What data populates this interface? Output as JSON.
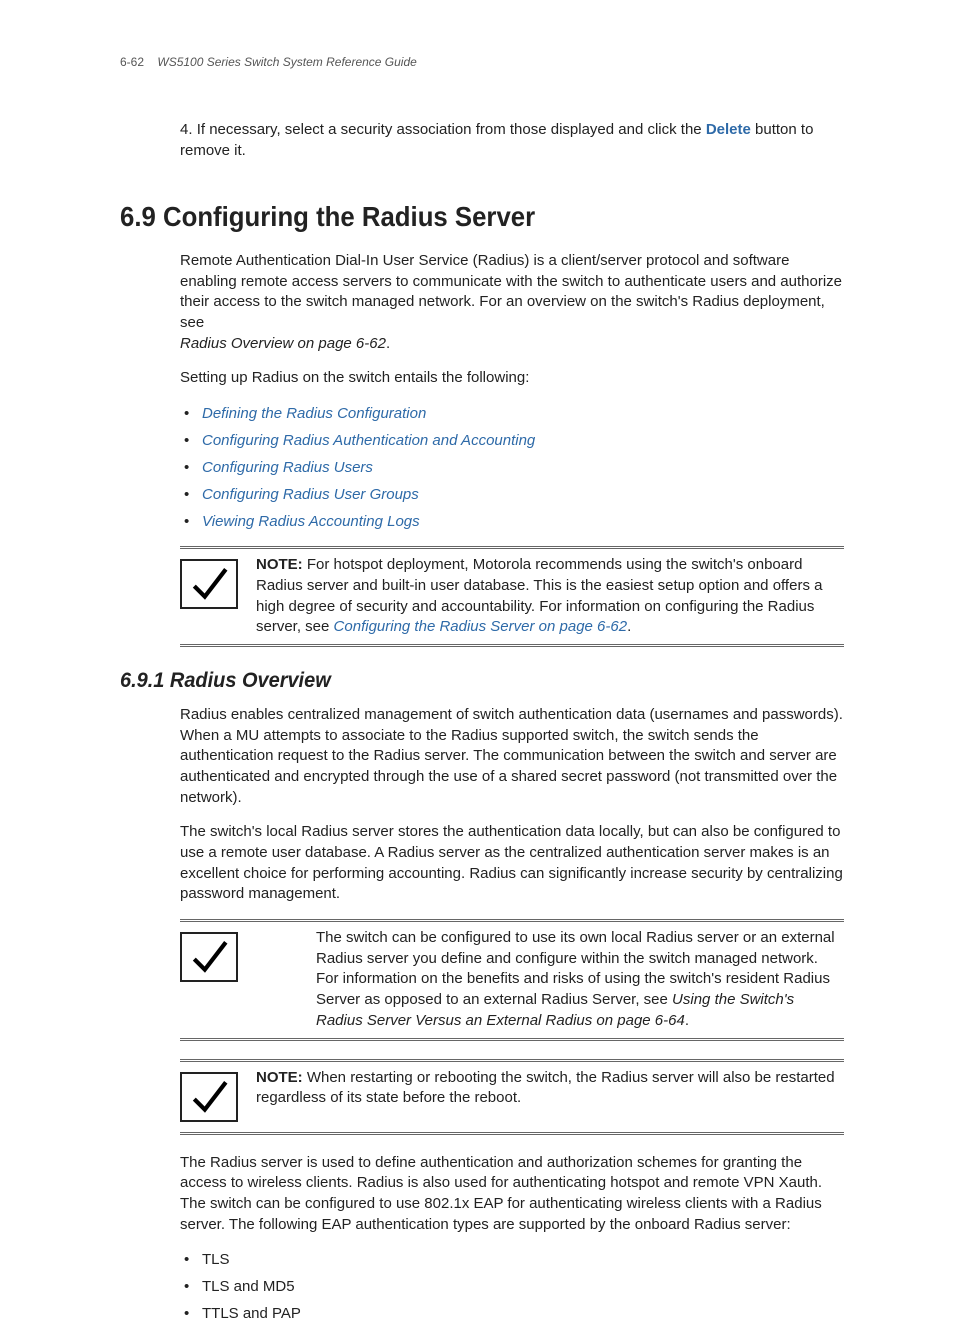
{
  "header": {
    "pageno": "6-62",
    "title": "WS5100 Series Switch System Reference Guide"
  },
  "step": {
    "num": "4.",
    "pre": "If necessary, select a security association from those displayed and click the ",
    "link": "Delete",
    "post": " button to remove it."
  },
  "sec69": {
    "number": "6.9",
    "title": "Configuring the Radius Server",
    "para1": "Remote Authentication Dial-In User Service (Radius) is a client/server protocol and software enabling remote access servers to communicate with the switch to authenticate users and authorize their access to the switch managed network. For an overview on the switch's Radius deployment, see",
    "para1_ref": "Radius Overview on page 6-62",
    "para2": "Setting up Radius on the switch entails the following:",
    "bullets": [
      "Defining the Radius Configuration",
      "Configuring Radius Authentication and Accounting",
      "Configuring Radius Users",
      "Configuring Radius User Groups",
      "Viewing Radius Accounting Logs"
    ]
  },
  "note1": {
    "label": "NOTE:",
    "text": " For hotspot deployment, Motorola recommends using the switch's onboard Radius server and built-in user database. This is the easiest setup option and offers a high degree of security and accountability. For information on configuring the Radius server, see ",
    "link": "Configuring the Radius Server on page 6-62",
    "post": "."
  },
  "sec691": {
    "number": "6.9.1",
    "title": "Radius Overview",
    "para1": "Radius enables centralized management of switch authentication data (usernames and passwords). When a MU attempts to associate to the Radius supported switch, the switch sends the authentication request to the Radius server. The communication between the switch and server are authenticated and encrypted through the use of a shared secret password (not transmitted over the network).",
    "para2": "The switch's local Radius server stores the authentication data locally, but can also be configured to use a remote user database. A Radius server as the centralized authentication server makes is an excellent choice for performing accounting. Radius can significantly increase security by centralizing password management."
  },
  "note2": {
    "text_pre": "The switch can be configured to use its own local Radius server or an external Radius server you define and configure within the switch managed network. For information on the benefits and risks of using the switch's resident Radius Server as opposed to an external Radius Server, see ",
    "ref": "Using the Switch's Radius Server Versus an External Radius on page 6-64",
    "post": "."
  },
  "note3": {
    "label": "NOTE:",
    "text": " When restarting or rebooting the switch, the Radius server will also be restarted regardless of its state before the reboot."
  },
  "para_after": "The Radius server is used to define authentication and authorization schemes for granting the access to wireless clients. Radius is also used for authenticating hotspot and remote VPN Xauth. The switch can be configured to use 802.1x EAP for authenticating wireless clients with a Radius server. The following EAP authentication types are supported by the onboard Radius server:",
  "eap_types": [
    "TLS",
    "TLS and MD5",
    "TTLS and PAP"
  ]
}
